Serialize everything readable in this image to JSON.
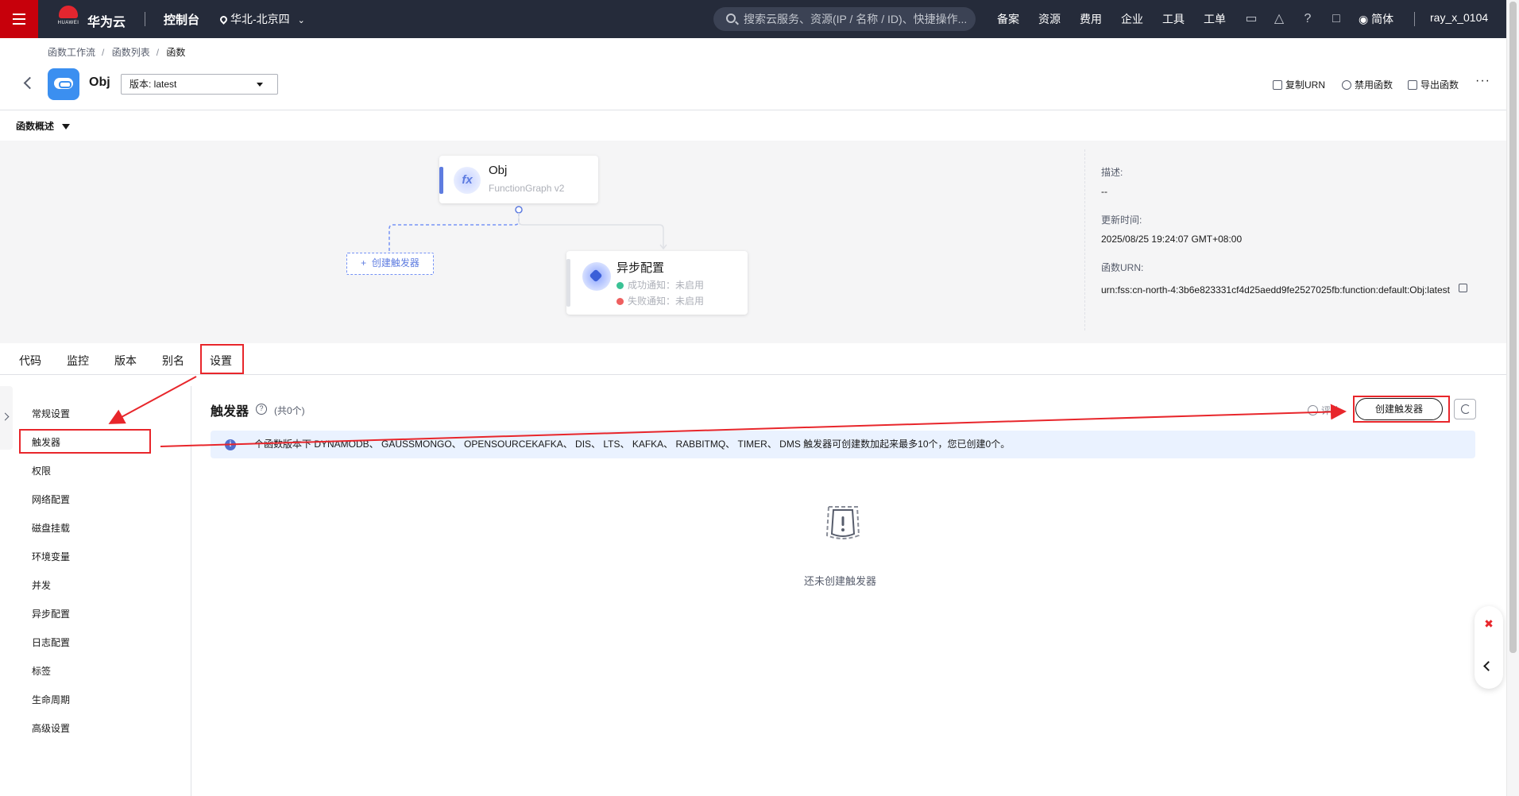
{
  "topbar": {
    "logo_text": "HUAWEI",
    "brand": "华为云",
    "console": "控制台",
    "region": "华北-北京四",
    "search_placeholder": "搜索云服务、资源(IP / 名称 / ID)、快捷操作...",
    "nav": [
      "备案",
      "资源",
      "费用",
      "企业",
      "工具",
      "工单"
    ],
    "language": "简体",
    "username": "ray_x_0104"
  },
  "breadcrumb": [
    "函数工作流",
    "函数列表",
    "函数"
  ],
  "function": {
    "name": "Obj",
    "version_select": "版本: latest",
    "actions": [
      "复制URN",
      "禁用函数",
      "导出函数"
    ]
  },
  "overview": {
    "label": "函数概述",
    "main_card": {
      "title": "Obj",
      "subtitle": "FunctionGraph v2"
    },
    "create_trigger": "创建触发器",
    "async_card": {
      "title": "异步配置",
      "success": "成功通知：未启用",
      "fail": "失败通知：未启用"
    },
    "info": {
      "desc_label": "描述:",
      "desc_value": "--",
      "updated_label": "更新时间:",
      "updated_value": "2025/08/25 19:24:07 GMT+08:00",
      "urn_label": "函数URN:",
      "urn_value": "urn:fss:cn-north-4:3b6e823331cf4d25aedd9fe2527025fb:function:default:Obj:latest"
    }
  },
  "tabs": [
    "代码",
    "监控",
    "版本",
    "别名",
    "设置"
  ],
  "sidebar": [
    "常规设置",
    "触发器",
    "权限",
    "网络配置",
    "磁盘挂载",
    "环境变量",
    "并发",
    "异步配置",
    "日志配置",
    "标签",
    "生命周期",
    "高级设置"
  ],
  "panel": {
    "title": "触发器",
    "count": "(共0个)",
    "eval": "评价",
    "create_button": "创建触发器",
    "notice": "个函数版本下 DYNAMODB、 GAUSSMONGO、 OPENSOURCEKAFKA、 DIS、 LTS、 KAFKA、 RABBITMQ、 TIMER、 DMS 触发器可创建数加起来最多10个，您已创建0个。",
    "empty": "还未创建触发器"
  },
  "colors": {
    "topbar": "#252b3a",
    "brand_red": "#c7000b",
    "accent": "#5e7ce0",
    "annotation_red": "#e8262b"
  }
}
